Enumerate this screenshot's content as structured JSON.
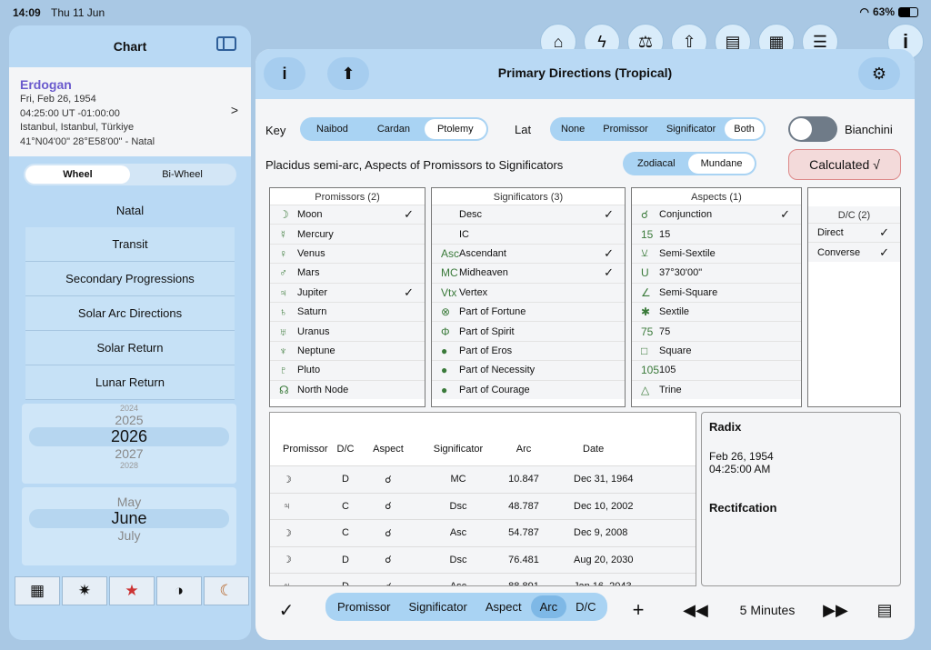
{
  "status": {
    "time": "14:09",
    "date": "Thu 11 Jun",
    "battery": "63%"
  },
  "toolbar_icons": [
    "home-icon",
    "flash-icon",
    "scale-icon",
    "share-icon",
    "document-icon",
    "grid-icon",
    "list-icon",
    "info-icon"
  ],
  "left": {
    "title": "Chart",
    "person": {
      "name": "Erdogan",
      "line1": "Fri, Feb 26, 1954",
      "line2": "04:25:00 UT -01:00:00",
      "line3": "Istanbul, Istanbul, Türkiye",
      "line4": "41°N04'00\" 28°E58'00\" - Natal"
    },
    "wheel": "Wheel",
    "biwheel": "Bi-Wheel",
    "menu": [
      "Natal",
      "Transit",
      "Secondary Progressions",
      "Solar Arc Directions",
      "Solar Return",
      "Lunar Return"
    ],
    "years": [
      "2024",
      "2025",
      "2026",
      "2027",
      "2028"
    ],
    "months": [
      "May",
      "June",
      "July"
    ]
  },
  "main": {
    "title": "Primary Directions (Tropical)",
    "key_label": "Key",
    "keys": [
      "Naibod",
      "Cardan",
      "Ptolemy"
    ],
    "lat_label": "Lat",
    "lats": [
      "None",
      "Promissor",
      "Significator",
      "Both"
    ],
    "bianchini": "Bianchini",
    "desc": "Placidus semi-arc, Aspects of Promissors to Significators",
    "zm": [
      "Zodiacal",
      "Mundane"
    ],
    "calculated": "Calculated √",
    "prom_header": "Promissors (2)",
    "promissors": [
      {
        "s": "☽",
        "n": "Moon",
        "c": "✓"
      },
      {
        "s": "☿",
        "n": "Mercury",
        "c": ""
      },
      {
        "s": "♀",
        "n": "Venus",
        "c": ""
      },
      {
        "s": "♂",
        "n": "Mars",
        "c": ""
      },
      {
        "s": "♃",
        "n": "Jupiter",
        "c": "✓"
      },
      {
        "s": "♄",
        "n": "Saturn",
        "c": ""
      },
      {
        "s": "♅",
        "n": "Uranus",
        "c": ""
      },
      {
        "s": "♆",
        "n": "Neptune",
        "c": ""
      },
      {
        "s": "♇",
        "n": "Pluto",
        "c": ""
      },
      {
        "s": "☊",
        "n": "North Node",
        "c": ""
      }
    ],
    "sig_header": "Significators (3)",
    "significators": [
      {
        "s": "",
        "n": "Desc",
        "c": "✓"
      },
      {
        "s": "",
        "n": "IC",
        "c": ""
      },
      {
        "s": "Asc",
        "n": "Ascendant",
        "c": "✓"
      },
      {
        "s": "MC",
        "n": "Midheaven",
        "c": "✓"
      },
      {
        "s": "Vtx",
        "n": "Vertex",
        "c": ""
      },
      {
        "s": "⊗",
        "n": "Part of Fortune",
        "c": ""
      },
      {
        "s": "Φ",
        "n": "Part of Spirit",
        "c": ""
      },
      {
        "s": "●",
        "n": "Part of Eros",
        "c": ""
      },
      {
        "s": "●",
        "n": "Part of Necessity",
        "c": ""
      },
      {
        "s": "●",
        "n": "Part of Courage",
        "c": ""
      }
    ],
    "asp_header": "Aspects (1)",
    "aspects": [
      {
        "s": "☌",
        "n": "Conjunction",
        "c": "✓"
      },
      {
        "s": "15",
        "n": "15",
        "c": ""
      },
      {
        "s": "⚺",
        "n": "Semi-Sextile",
        "c": ""
      },
      {
        "s": "U",
        "n": "37°30'00\"",
        "c": ""
      },
      {
        "s": "∠",
        "n": "Semi-Square",
        "c": ""
      },
      {
        "s": "✱",
        "n": "Sextile",
        "c": ""
      },
      {
        "s": "75",
        "n": "75",
        "c": ""
      },
      {
        "s": "□",
        "n": "Square",
        "c": ""
      },
      {
        "s": "105",
        "n": "105",
        "c": ""
      },
      {
        "s": "△",
        "n": "Trine",
        "c": ""
      }
    ],
    "dc_header": "D/C (2)",
    "dc": [
      {
        "n": "Direct",
        "c": "✓"
      },
      {
        "n": "Converse",
        "c": "✓"
      }
    ],
    "table_headers": [
      "Promissor",
      "D/C",
      "Aspect",
      "Significator",
      "Arc",
      "Date"
    ],
    "rows": [
      [
        "☽",
        "D",
        "☌",
        "MC",
        "10.847",
        "Dec 31, 1964"
      ],
      [
        "♃",
        "C",
        "☌",
        "Dsc",
        "48.787",
        "Dec 10, 2002"
      ],
      [
        "☽",
        "C",
        "☌",
        "Asc",
        "54.787",
        "Dec 9, 2008"
      ],
      [
        "☽",
        "D",
        "☌",
        "Dsc",
        "76.481",
        "Aug 20, 2030"
      ],
      [
        "♃",
        "D",
        "☌",
        "Asc",
        "88.891",
        "Jan 16, 2043"
      ]
    ],
    "radix": {
      "title": "Radix",
      "line1": "Feb 26, 1954",
      "line2": "04:25:00 AM",
      "rect": "Rectifcation"
    },
    "bottom": {
      "check": "✓",
      "tabs": [
        "Promissor",
        "Significator",
        "Aspect",
        "Arc",
        "D/C"
      ],
      "plus": "+",
      "interval": "5 Minutes"
    }
  }
}
